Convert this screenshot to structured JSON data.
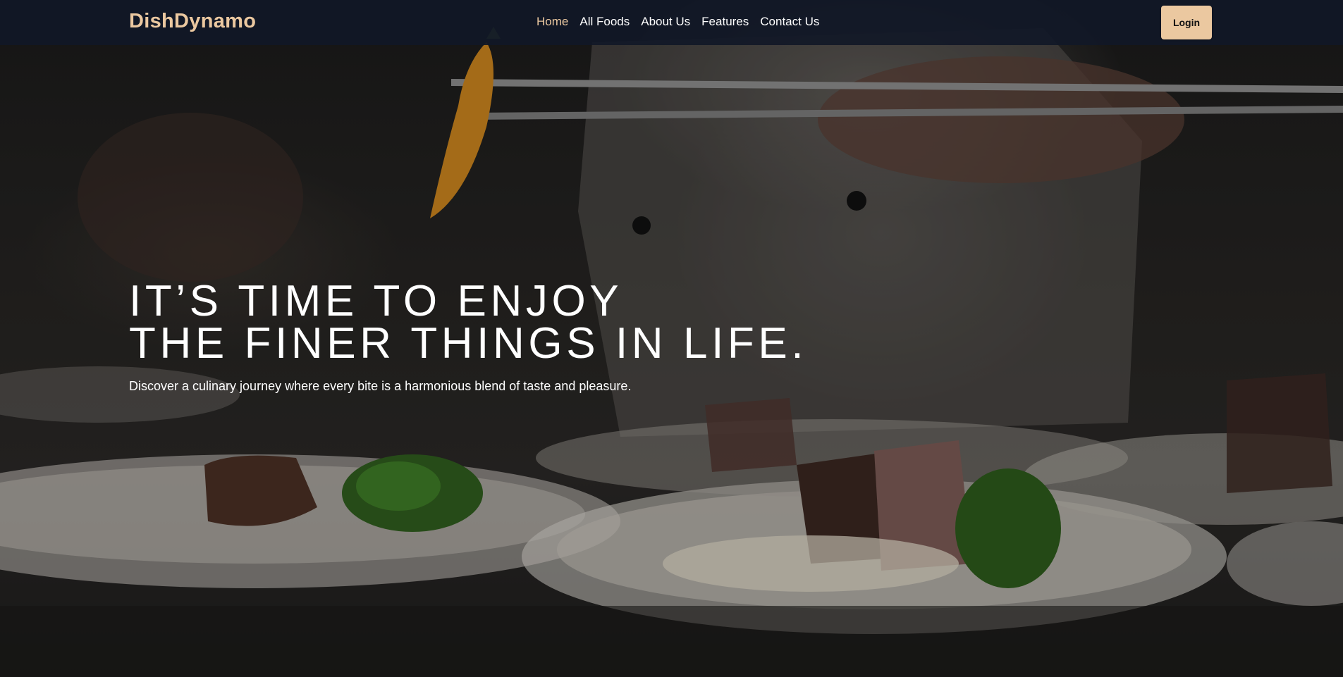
{
  "navbar": {
    "brand": "DishDynamo",
    "links": [
      {
        "label": "Home",
        "active": true
      },
      {
        "label": "All Foods",
        "active": false
      },
      {
        "label": "About Us",
        "active": false
      },
      {
        "label": "Features",
        "active": false
      },
      {
        "label": "Contact Us",
        "active": false
      }
    ],
    "login_label": "Login"
  },
  "hero": {
    "headline_line1": "IT’S TIME TO ENJOY",
    "headline_line2": "THE FINER THINGS IN LIFE.",
    "subtitle": "Discover a culinary journey where every bite is a harmonious blend of taste and pleasure."
  },
  "colors": {
    "accent": "#EBC8A0",
    "navbar_bg": "#111827",
    "text": "#FFFFFF"
  }
}
